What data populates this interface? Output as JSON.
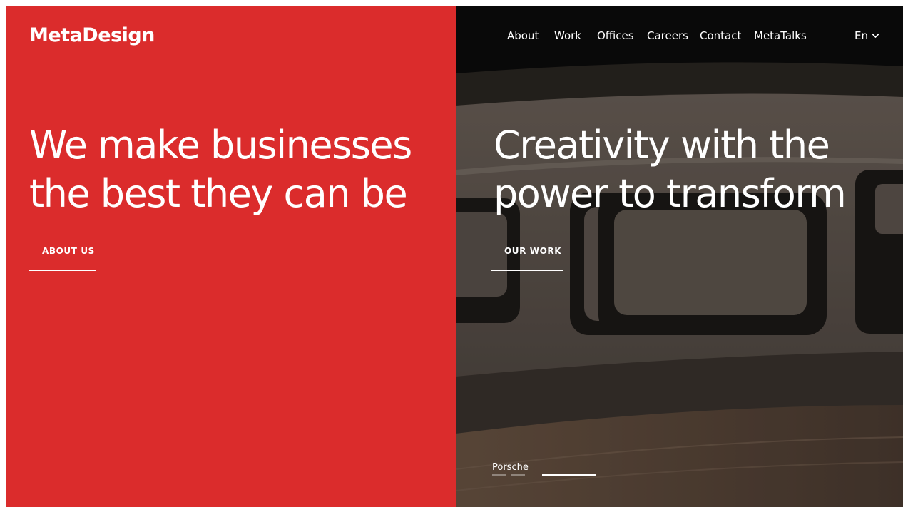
{
  "brand": {
    "logo_text": "MetaDesign",
    "accent_color": "#db2c2c"
  },
  "nav": {
    "items": [
      {
        "label": "About"
      },
      {
        "label": "Work"
      },
      {
        "label": "Offices"
      },
      {
        "label": "Careers"
      },
      {
        "label": "Contact"
      },
      {
        "label": "MetaTalks"
      }
    ],
    "language": "En",
    "language_icon": "chevron-down-icon"
  },
  "left": {
    "headline_line1": "We make businesses",
    "headline_line2": "the best they can be",
    "cta_label": "ABOUT US"
  },
  "right": {
    "headline_line1": "Creativity with the",
    "headline_line2": "power to transform",
    "cta_label": "OUR WORK",
    "slide_caption": "Porsche",
    "slides_total": 3,
    "active_slide": 2
  }
}
